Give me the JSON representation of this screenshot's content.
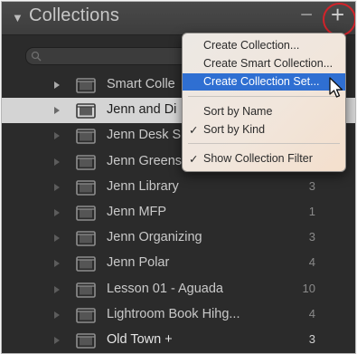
{
  "panel": {
    "title": "Collections",
    "minus": "−",
    "plus": "+"
  },
  "icons": {
    "disclosure": "triangle-down-icon",
    "search": "search-icon",
    "folder": "collection-set-icon",
    "cursor": "pointer-cursor-icon"
  },
  "colors": {
    "panel_bg": "#2b2b2b",
    "selected_row": "#d4d4d4",
    "menu_highlight": "#2f6fd2",
    "annotation_circle": "#d2232a"
  },
  "collections": [
    {
      "label": "Smart Colle",
      "count": "",
      "state": "normal"
    },
    {
      "label": "Jenn and Di",
      "count": "",
      "state": "selected"
    },
    {
      "label": "Jenn Desk S",
      "count": "",
      "state": "normal"
    },
    {
      "label": "Jenn Greens",
      "count": "",
      "state": "normal"
    },
    {
      "label": "Jenn Library",
      "count": "3",
      "state": "normal"
    },
    {
      "label": "Jenn MFP",
      "count": "1",
      "state": "normal"
    },
    {
      "label": "Jenn Organizing",
      "count": "3",
      "state": "normal"
    },
    {
      "label": "Jenn Polar",
      "count": "4",
      "state": "normal"
    },
    {
      "label": "Lesson 01 - Aguada",
      "count": "10",
      "state": "normal"
    },
    {
      "label": "Lightroom Book Hihg...",
      "count": "4",
      "state": "normal"
    },
    {
      "label": "Old Town +",
      "count": "3",
      "state": "bright"
    }
  ],
  "menu": {
    "create_collection": "Create Collection...",
    "create_smart_collection": "Create Smart Collection...",
    "create_collection_set": "Create Collection Set...",
    "sort_by_name": "Sort by Name",
    "sort_by_kind": "Sort by Kind",
    "show_collection_filter": "Show Collection Filter",
    "check": "✓"
  }
}
